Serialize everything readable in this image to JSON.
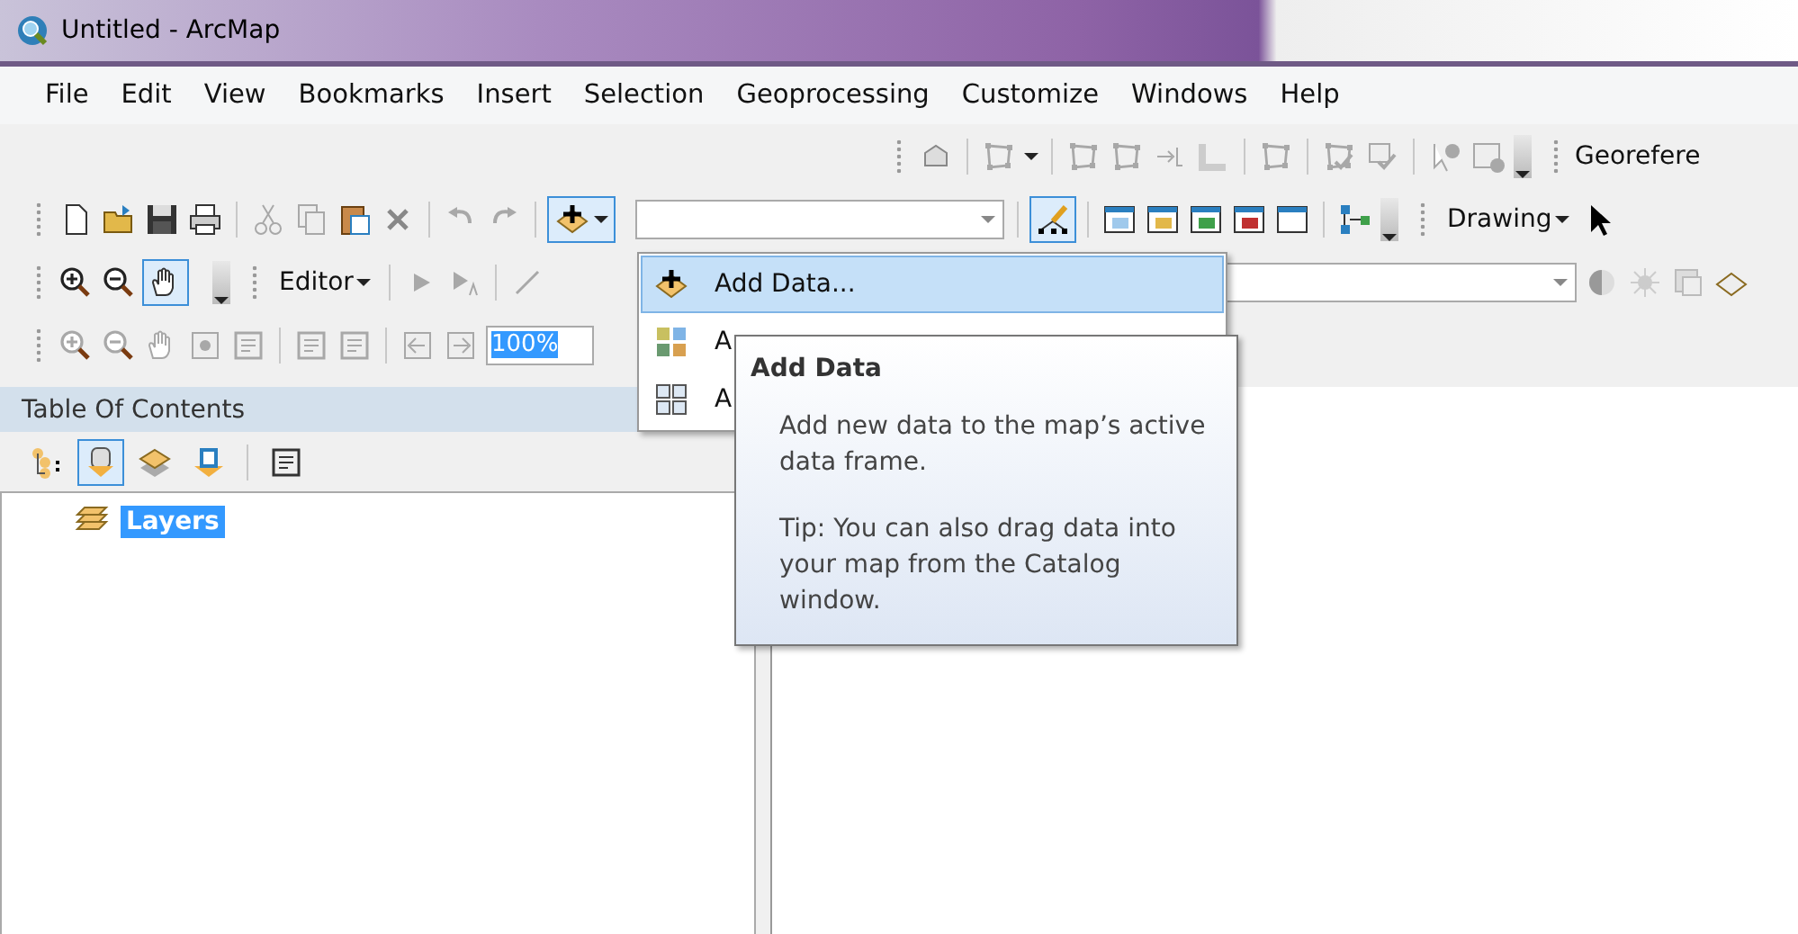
{
  "window": {
    "title": "Untitled - ArcMap"
  },
  "menu_bar": [
    "File",
    "Edit",
    "View",
    "Bookmarks",
    "Insert",
    "Selection",
    "Geoprocessing",
    "Customize",
    "Windows",
    "Help"
  ],
  "georeferencing_toolbar": {
    "label": "Georefere"
  },
  "standard_toolbar": {
    "add_data_pressed": true,
    "editor_tool_selected": true
  },
  "drawing_toolbar": {
    "label": "Drawing"
  },
  "editor_toolbar": {
    "label": "Editor"
  },
  "tools_toolbar": {
    "pan_selected": true
  },
  "layout_toolbar": {
    "zoom_value": "100%"
  },
  "add_data_menu": [
    {
      "label": "Add Data...",
      "selected": true
    },
    {
      "label": "A",
      "selected": false
    },
    {
      "label": "A",
      "selected": false
    }
  ],
  "tooltip": {
    "title": "Add Data",
    "paragraphs": [
      "Add new data to the map’s active data frame.",
      "Tip: You can also drag data into your map from the Catalog window."
    ]
  },
  "table_of_contents": {
    "title": "Table Of Contents",
    "view_buttons": [
      {
        "selected": false
      },
      {
        "selected": true
      },
      {
        "selected": false
      },
      {
        "selected": false
      },
      {
        "selected": false
      }
    ],
    "tree": [
      {
        "label": "Layers",
        "selected": true
      }
    ]
  }
}
